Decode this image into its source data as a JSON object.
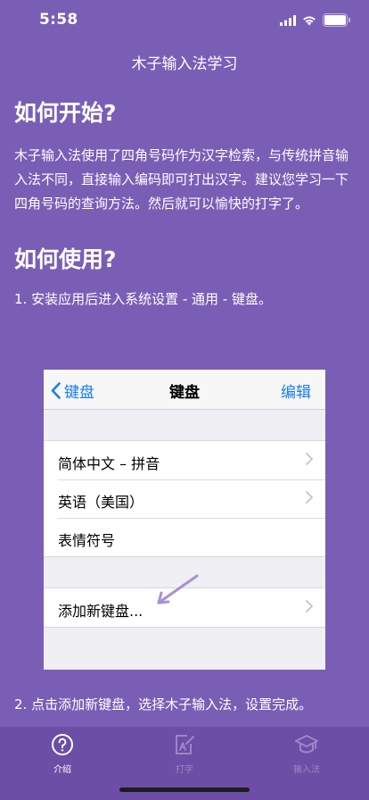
{
  "status_bar": {
    "time": "5:58",
    "icons": [
      "signal-icon",
      "wifi-icon",
      "battery-icon"
    ]
  },
  "nav": {
    "title": "木子输入法学习"
  },
  "section1": {
    "heading": "如何开始?",
    "body": "木子输入法使用了四角号码作为汉字检索，与传统拼音输入法不同，直接输入编码即可打出汉字。建议您学习一下四角号码的查询方法。然后就可以愉快的打字了。"
  },
  "section2": {
    "heading": "如何使用?",
    "step1": "1. 安装应用后进入系统设置 - 通用 - 键盘。",
    "step2": "2. 点击添加新键盘，选择木子输入法，设置完成。"
  },
  "settings_screenshot": {
    "back_label": "键盘",
    "title": "键盘",
    "edit_label": "编辑",
    "keyboards": [
      "简体中文 – 拼音",
      "英语（美国）",
      "表情符号"
    ],
    "add_keyboard": "添加新键盘..."
  },
  "tab_bar": {
    "tabs": [
      {
        "label": "介绍",
        "icon": "question-circle-icon",
        "active": true
      },
      {
        "label": "打字",
        "icon": "edit-document-icon",
        "active": false
      },
      {
        "label": "输入法",
        "icon": "graduation-cap-icon",
        "active": false
      }
    ]
  },
  "colors": {
    "background": "#7a5eb6",
    "tab_bar": "#6c4ea6",
    "ios_blue": "#1a7cf5",
    "annotation_arrow": "#a88fd4"
  }
}
